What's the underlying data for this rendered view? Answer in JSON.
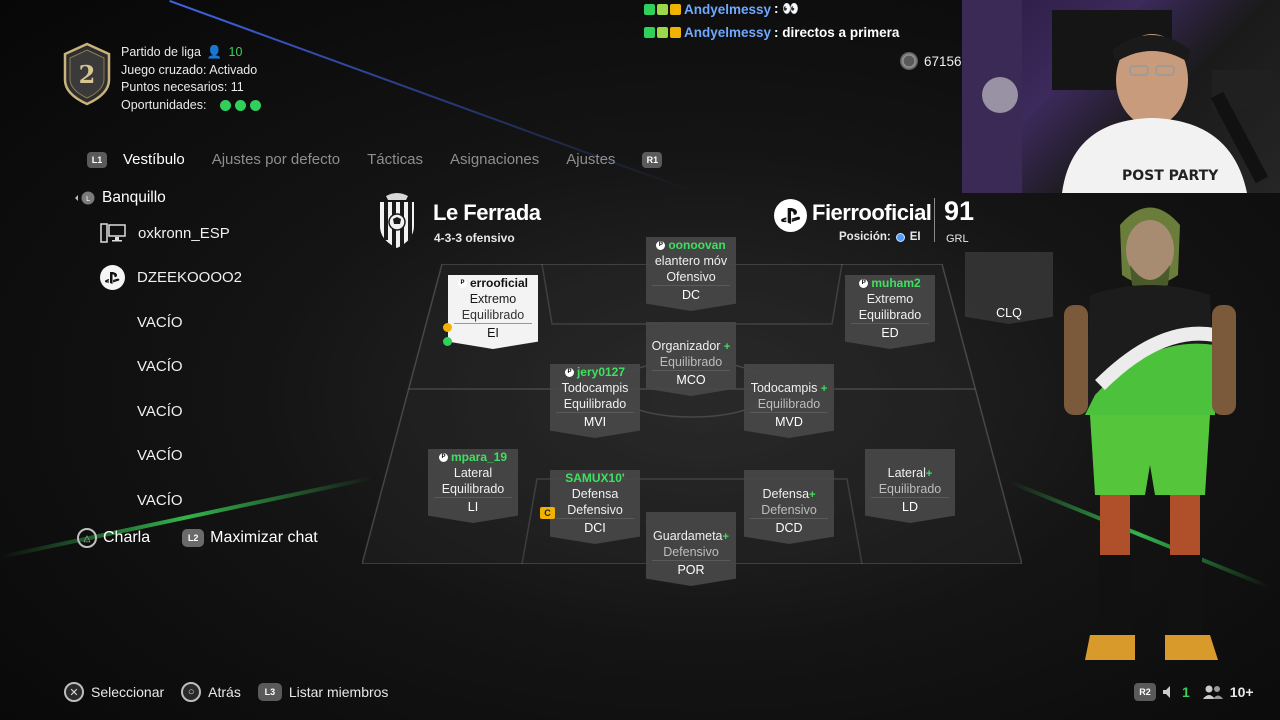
{
  "match_info": {
    "level": "2",
    "mode": "Partido de liga",
    "player_count": "10",
    "crossplay": "Juego cruzado: Activado",
    "points_needed": "Puntos necesarios: 11",
    "chances_label": "Oportunidades:",
    "chances_remaining": 3
  },
  "nav": {
    "left_button": "L1",
    "right_button": "R1",
    "tabs": [
      {
        "label": "Vestíbulo",
        "active": true
      },
      {
        "label": "Ajustes por defecto",
        "active": false
      },
      {
        "label": "Tácticas",
        "active": false
      },
      {
        "label": "Asignaciones",
        "active": false
      },
      {
        "label": "Ajustes",
        "active": false
      }
    ]
  },
  "lobby": {
    "header": "Banquillo",
    "members": [
      {
        "name": "oxkronn_ESP",
        "platform": "pc-icon"
      },
      {
        "name": "DZEEKOOOO2",
        "platform": "playstation-icon"
      },
      {
        "name": "VACÍO",
        "platform": ""
      },
      {
        "name": "VACÍO",
        "platform": ""
      },
      {
        "name": "VACÍO",
        "platform": ""
      },
      {
        "name": "VACÍO",
        "platform": ""
      },
      {
        "name": "VACÍO",
        "platform": ""
      }
    ],
    "chat_label": "Charla",
    "maximize_button": "L2",
    "maximize_label": "Maximizar chat"
  },
  "team": {
    "club": "Le Ferrada",
    "formation": "4-3-3 ofensivo",
    "user": "Fierrooficial",
    "position_label": "Posición:",
    "position": "EI",
    "rating": "91",
    "rating_label": "GRL"
  },
  "chat_overlay": [
    {
      "user": "Andyelmessy",
      "message": ": 👀"
    },
    {
      "user": "Andyelmessy",
      "message": ": directos a primera"
    }
  ],
  "coins": "67156",
  "players": [
    {
      "key": "ei",
      "name": "errooficial",
      "role": "Extremo",
      "style": "Equilibrado",
      "pos": "EI"
    },
    {
      "key": "dc",
      "name": "oonoovan",
      "role": "elantero móv",
      "style": "Ofensivo",
      "pos": "DC"
    },
    {
      "key": "ed",
      "name": "muham2",
      "role": "Extremo",
      "style": "Equilibrado",
      "pos": "ED"
    },
    {
      "key": "mco",
      "name": "",
      "role": "Organizador",
      "style": "Equilibrado",
      "pos": "MCO"
    },
    {
      "key": "mvi",
      "name": "jery0127",
      "role": "Todocampis",
      "style": "Equilibrado",
      "pos": "MVI"
    },
    {
      "key": "mvd",
      "name": "",
      "role": "Todocampis",
      "style": "Equilibrado",
      "pos": "MVD"
    },
    {
      "key": "li",
      "name": "mpara_19",
      "role": "Lateral",
      "style": "Equilibrado",
      "pos": "LI"
    },
    {
      "key": "dci",
      "name": "SAMUX10'",
      "role": "Defensa",
      "style": "Defensivo",
      "pos": "DCI"
    },
    {
      "key": "dcd",
      "name": "",
      "role": "Defensa",
      "style": "Defensivo",
      "pos": "DCD"
    },
    {
      "key": "ld",
      "name": "",
      "role": "Lateral",
      "style": "Equilibrado",
      "pos": "LD"
    },
    {
      "key": "por",
      "name": "",
      "role": "Guardameta",
      "style": "Defensivo",
      "pos": "POR"
    },
    {
      "key": "clq",
      "name": "",
      "role": "",
      "style": "",
      "pos": "CLQ"
    }
  ],
  "captain_badge": "C",
  "bottom_bar": {
    "select": "Seleccionar",
    "back": "Atrás",
    "list_button": "L3",
    "list": "Listar miembros",
    "r2": "R2",
    "mute_count": "1",
    "members_count": "10+"
  },
  "colors": {
    "accent_green": "#39d05a",
    "chat_user_blue": "#6fa8ff",
    "selected_card": "#f3f3f3"
  }
}
